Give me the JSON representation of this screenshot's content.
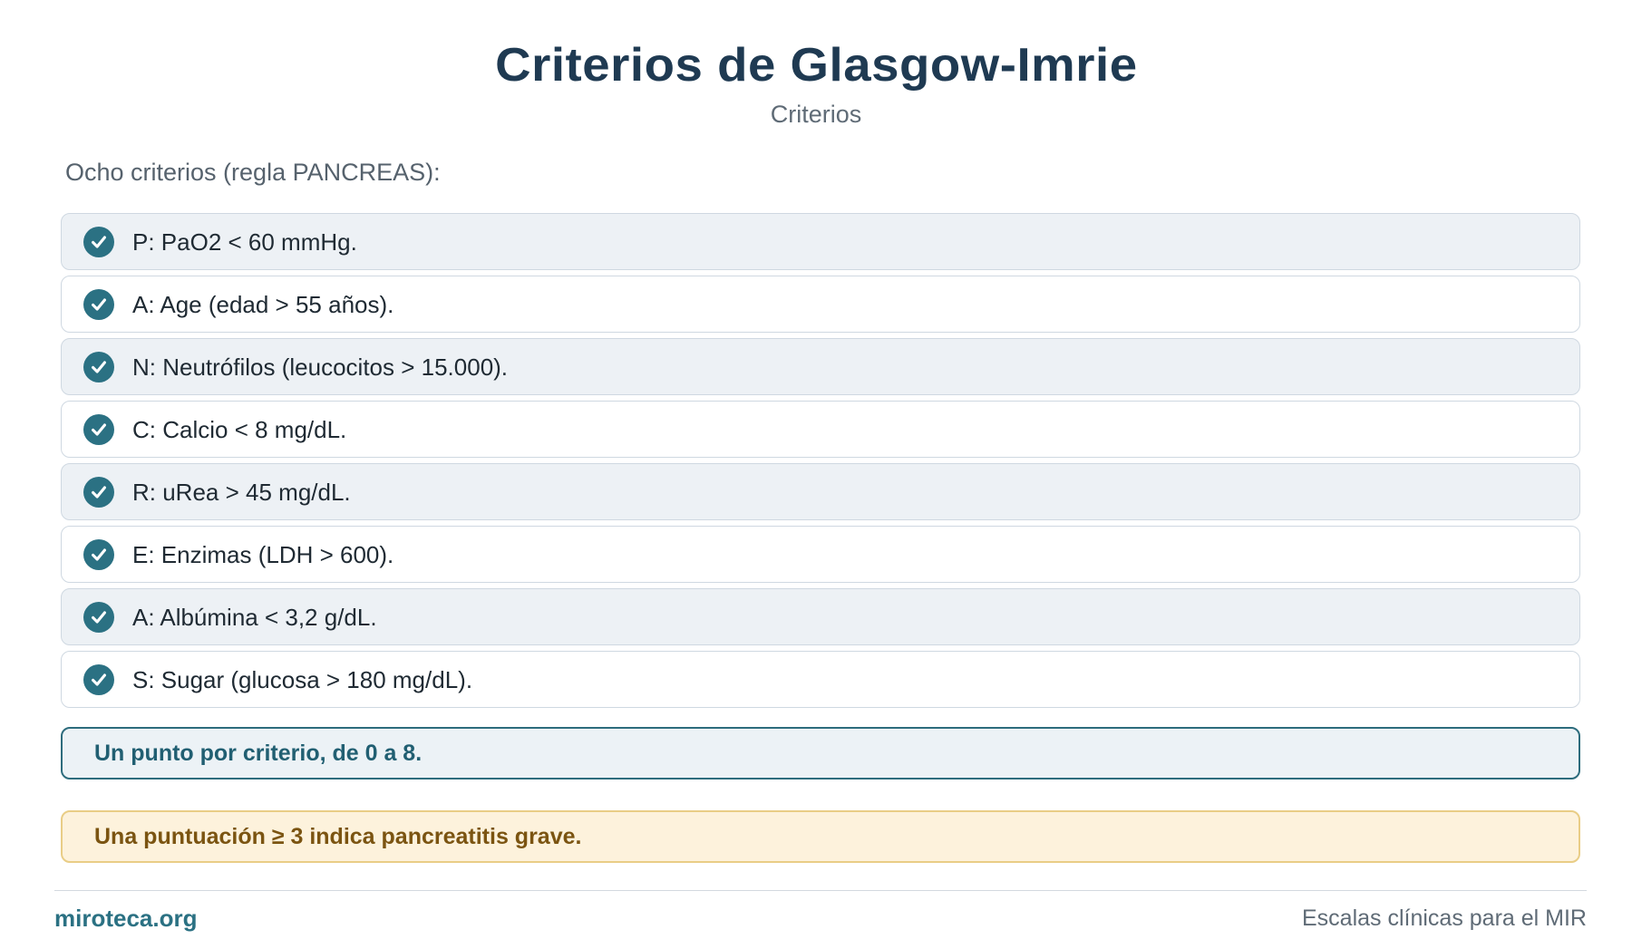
{
  "header": {
    "title": "Criterios de Glasgow-Imrie",
    "subtitle": "Criterios"
  },
  "intro": "Ocho criterios (regla PANCREAS):",
  "criteria": [
    {
      "text": "P: PaO2 < 60 mmHg.",
      "icon": "check-circle-icon"
    },
    {
      "text": "A: Age (edad > 55 años).",
      "icon": "check-circle-icon"
    },
    {
      "text": "N: Neutrófilos (leucocitos > 15.000).",
      "icon": "check-circle-icon"
    },
    {
      "text": "C: Calcio < 8 mg/dL.",
      "icon": "check-circle-icon"
    },
    {
      "text": "R: uRea > 45 mg/dL.",
      "icon": "check-circle-icon"
    },
    {
      "text": "E: Enzimas (LDH > 600).",
      "icon": "check-circle-icon"
    },
    {
      "text": "A: Albúmina < 3,2 g/dL.",
      "icon": "check-circle-icon"
    },
    {
      "text": "S: Sugar (glucosa > 180 mg/dL).",
      "icon": "check-circle-icon"
    }
  ],
  "notes": {
    "scoring": "Un punto por criterio, de 0 a 8.",
    "interpretation": "Una puntuación ≥ 3 indica pancreatitis grave."
  },
  "footer": {
    "brand": "miroteca.org",
    "tagline": "Escalas clínicas para el MIR"
  },
  "colors": {
    "title": "#1f3a52",
    "accent": "#2b7183",
    "info_border": "#2d6c7d",
    "warning_border": "#e9cd86",
    "warning_background": "#fdf2dc",
    "warning_text": "#7b5411"
  }
}
